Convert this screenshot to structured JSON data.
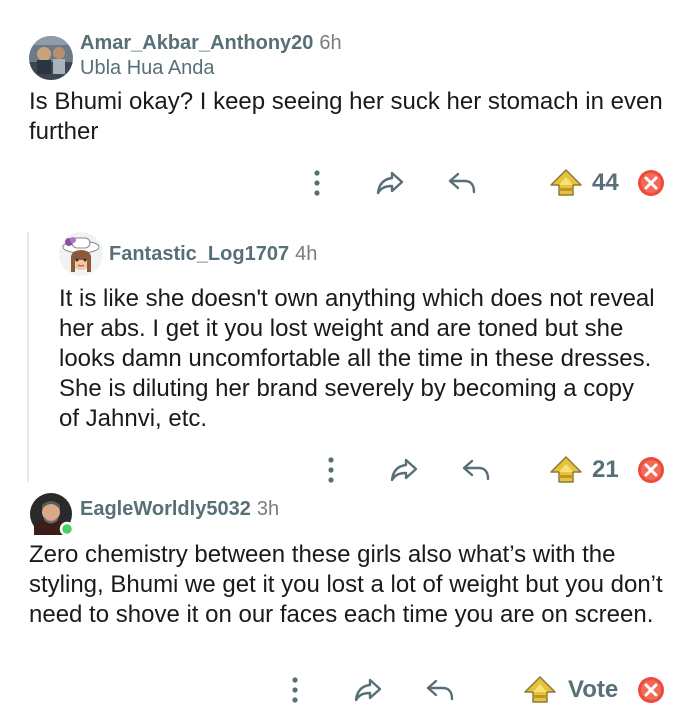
{
  "comments": [
    {
      "author": "Amar_Akbar_Anthony20",
      "age": "6h",
      "flair": "Ubla Hua Anda",
      "body": "Is Bhumi okay? I keep seeing her suck her stomach in even further",
      "votes": "44"
    },
    {
      "author": "Fantastic_Log1707",
      "age": "4h",
      "body": "It is like she doesn't own anything which does not reveal her abs. I get it you lost weight and are toned but she looks damn uncomfortable all the time in these dresses. She is diluting her brand severely by becoming a copy of Jahnvi, etc.",
      "votes": "21"
    },
    {
      "author": "EagleWorldly5032",
      "age": "3h",
      "body": "Zero chemistry between these girls also what’s with the styling, Bhumi we get it you lost a lot of weight but you don’t need to shove it on our faces each time you are on screen.",
      "votes": "Vote"
    }
  ],
  "colors": {
    "award_gold": "#e7c23a",
    "downvote_red": "#ee4a3a",
    "online_green": "#46d160",
    "meta_gray": "#576f76"
  },
  "icons": [
    "more-icon",
    "share-icon",
    "reply-icon",
    "upvote-award-icon",
    "downvote-icon"
  ]
}
